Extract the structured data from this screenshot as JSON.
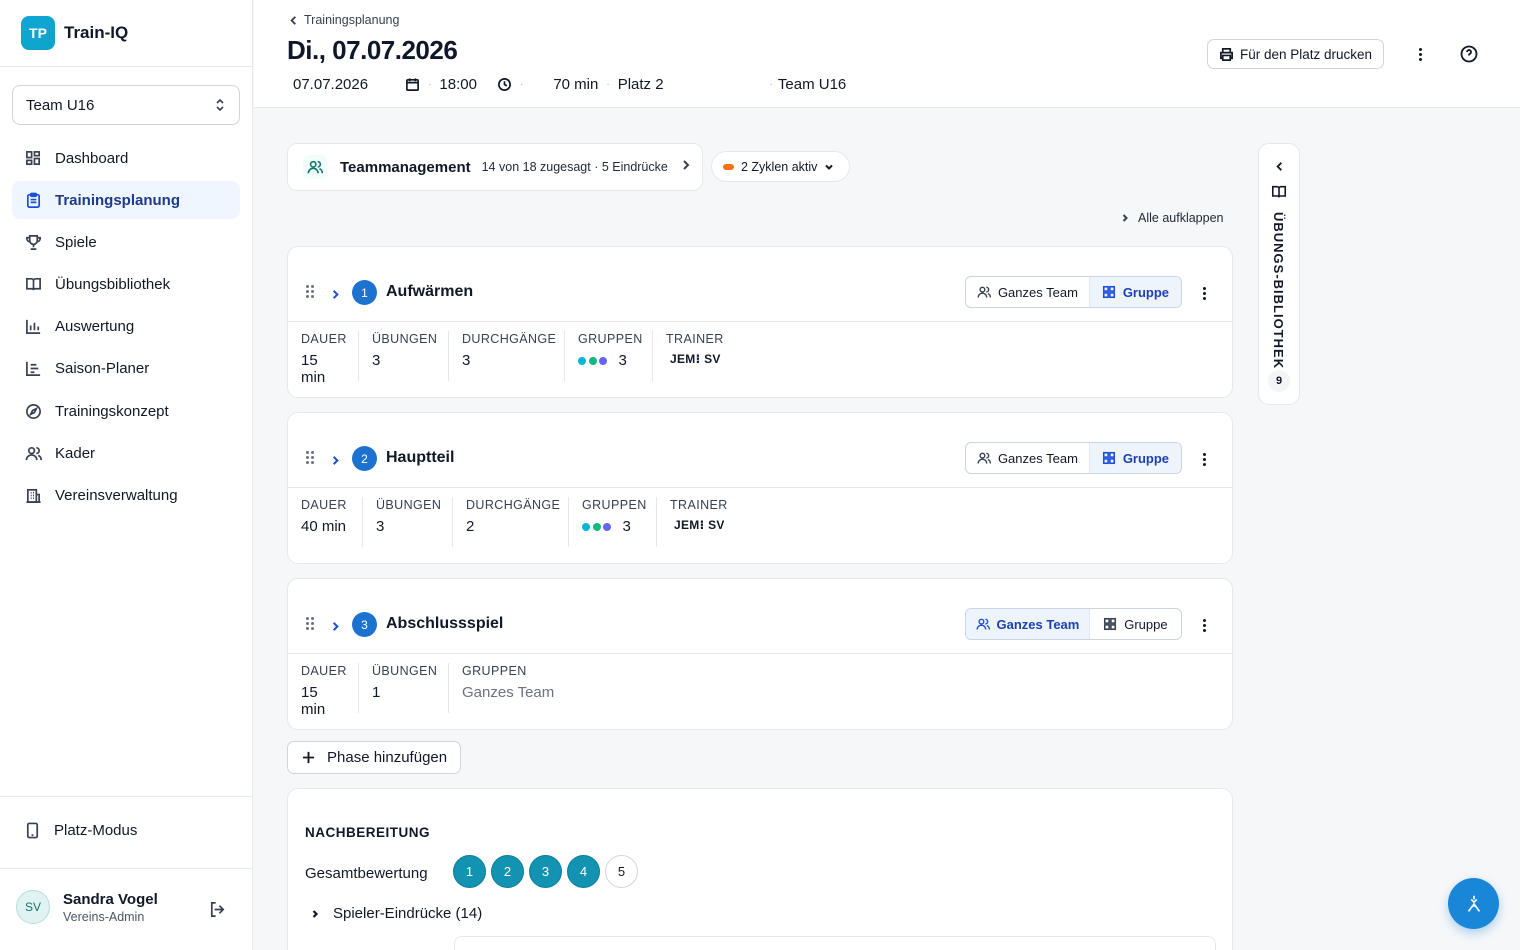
{
  "brand": {
    "logo": "TP",
    "name": "Train-IQ"
  },
  "team_select": {
    "value": "Team U16"
  },
  "nav": [
    {
      "label": "Dashboard",
      "icon": "dashboard-icon",
      "active": false
    },
    {
      "label": "Trainingsplanung",
      "icon": "clipboard-icon",
      "active": true
    },
    {
      "label": "Spiele",
      "icon": "trophy-icon",
      "active": false
    },
    {
      "label": "Übungsbibliothek",
      "icon": "book-icon",
      "active": false
    },
    {
      "label": "Auswertung",
      "icon": "bar-chart-icon",
      "active": false
    },
    {
      "label": "Saison-Planer",
      "icon": "gantt-icon",
      "active": false
    },
    {
      "label": "Trainingskonzept",
      "icon": "compass-icon",
      "active": false
    },
    {
      "label": "Kader",
      "icon": "users-icon",
      "active": false
    },
    {
      "label": "Vereinsverwaltung",
      "icon": "building-icon",
      "active": false
    }
  ],
  "platz_mode": {
    "label": "Platz-Modus",
    "icon": "tablet-icon"
  },
  "user": {
    "initials": "SV",
    "name": "Sandra Vogel",
    "role": "Vereins-Admin"
  },
  "header": {
    "breadcrumb": "Trainingsplanung",
    "title": "Di., 07.07.2026",
    "date": "07.07.2026",
    "time": "18:00",
    "duration": "70 min",
    "place": "Platz 2",
    "team": "Team U16",
    "print_label": "Für den Platz drucken"
  },
  "team_management": {
    "title": "Teammanagement",
    "summary": "14 von 18 zugesagt · 5 Eindrücke"
  },
  "cycles": {
    "label": "2 Zyklen aktiv",
    "color": "#f97316"
  },
  "expand_all": "Alle aufklappen",
  "segment_labels": {
    "team": "Ganzes Team",
    "group": "Gruppe"
  },
  "stat_labels": {
    "duration": "DAUER",
    "exercises": "ÜBUNGEN",
    "rounds": "DURCHGÄNGE",
    "groups": "GRUPPEN",
    "trainer": "TRAINER"
  },
  "phases": [
    {
      "number": "1",
      "title": "Aufwärmen",
      "mode": "group",
      "duration": "15 min",
      "exercises": "3",
      "rounds": "3",
      "groups": "3",
      "group_colors": [
        "#06b6d4",
        "#10b981",
        "#6366f1"
      ],
      "trainer": "JEM⁝ SV"
    },
    {
      "number": "2",
      "title": "Hauptteil",
      "mode": "group",
      "duration": "40 min",
      "exercises": "3",
      "rounds": "2",
      "groups": "3",
      "group_colors": [
        "#06b6d4",
        "#10b981",
        "#6366f1"
      ],
      "trainer": "JEM⁝ SV"
    },
    {
      "number": "3",
      "title": "Abschlussspiel",
      "mode": "team",
      "duration": "15 min",
      "exercises": "1",
      "groups": "Ganzes Team"
    }
  ],
  "add_phase": "Phase hinzufügen",
  "post": {
    "title": "NACHBEREITUNG",
    "rating_label": "Gesamtbewertung",
    "ratings": [
      "1",
      "2",
      "3",
      "4",
      "5"
    ],
    "rating_selected": 4,
    "rating_color": "#1293b1",
    "impressions": "Spieler-Eindrücke (14)"
  },
  "library": {
    "label": "ÜBUNGS-BIBLIOTHEK",
    "count": "9"
  }
}
